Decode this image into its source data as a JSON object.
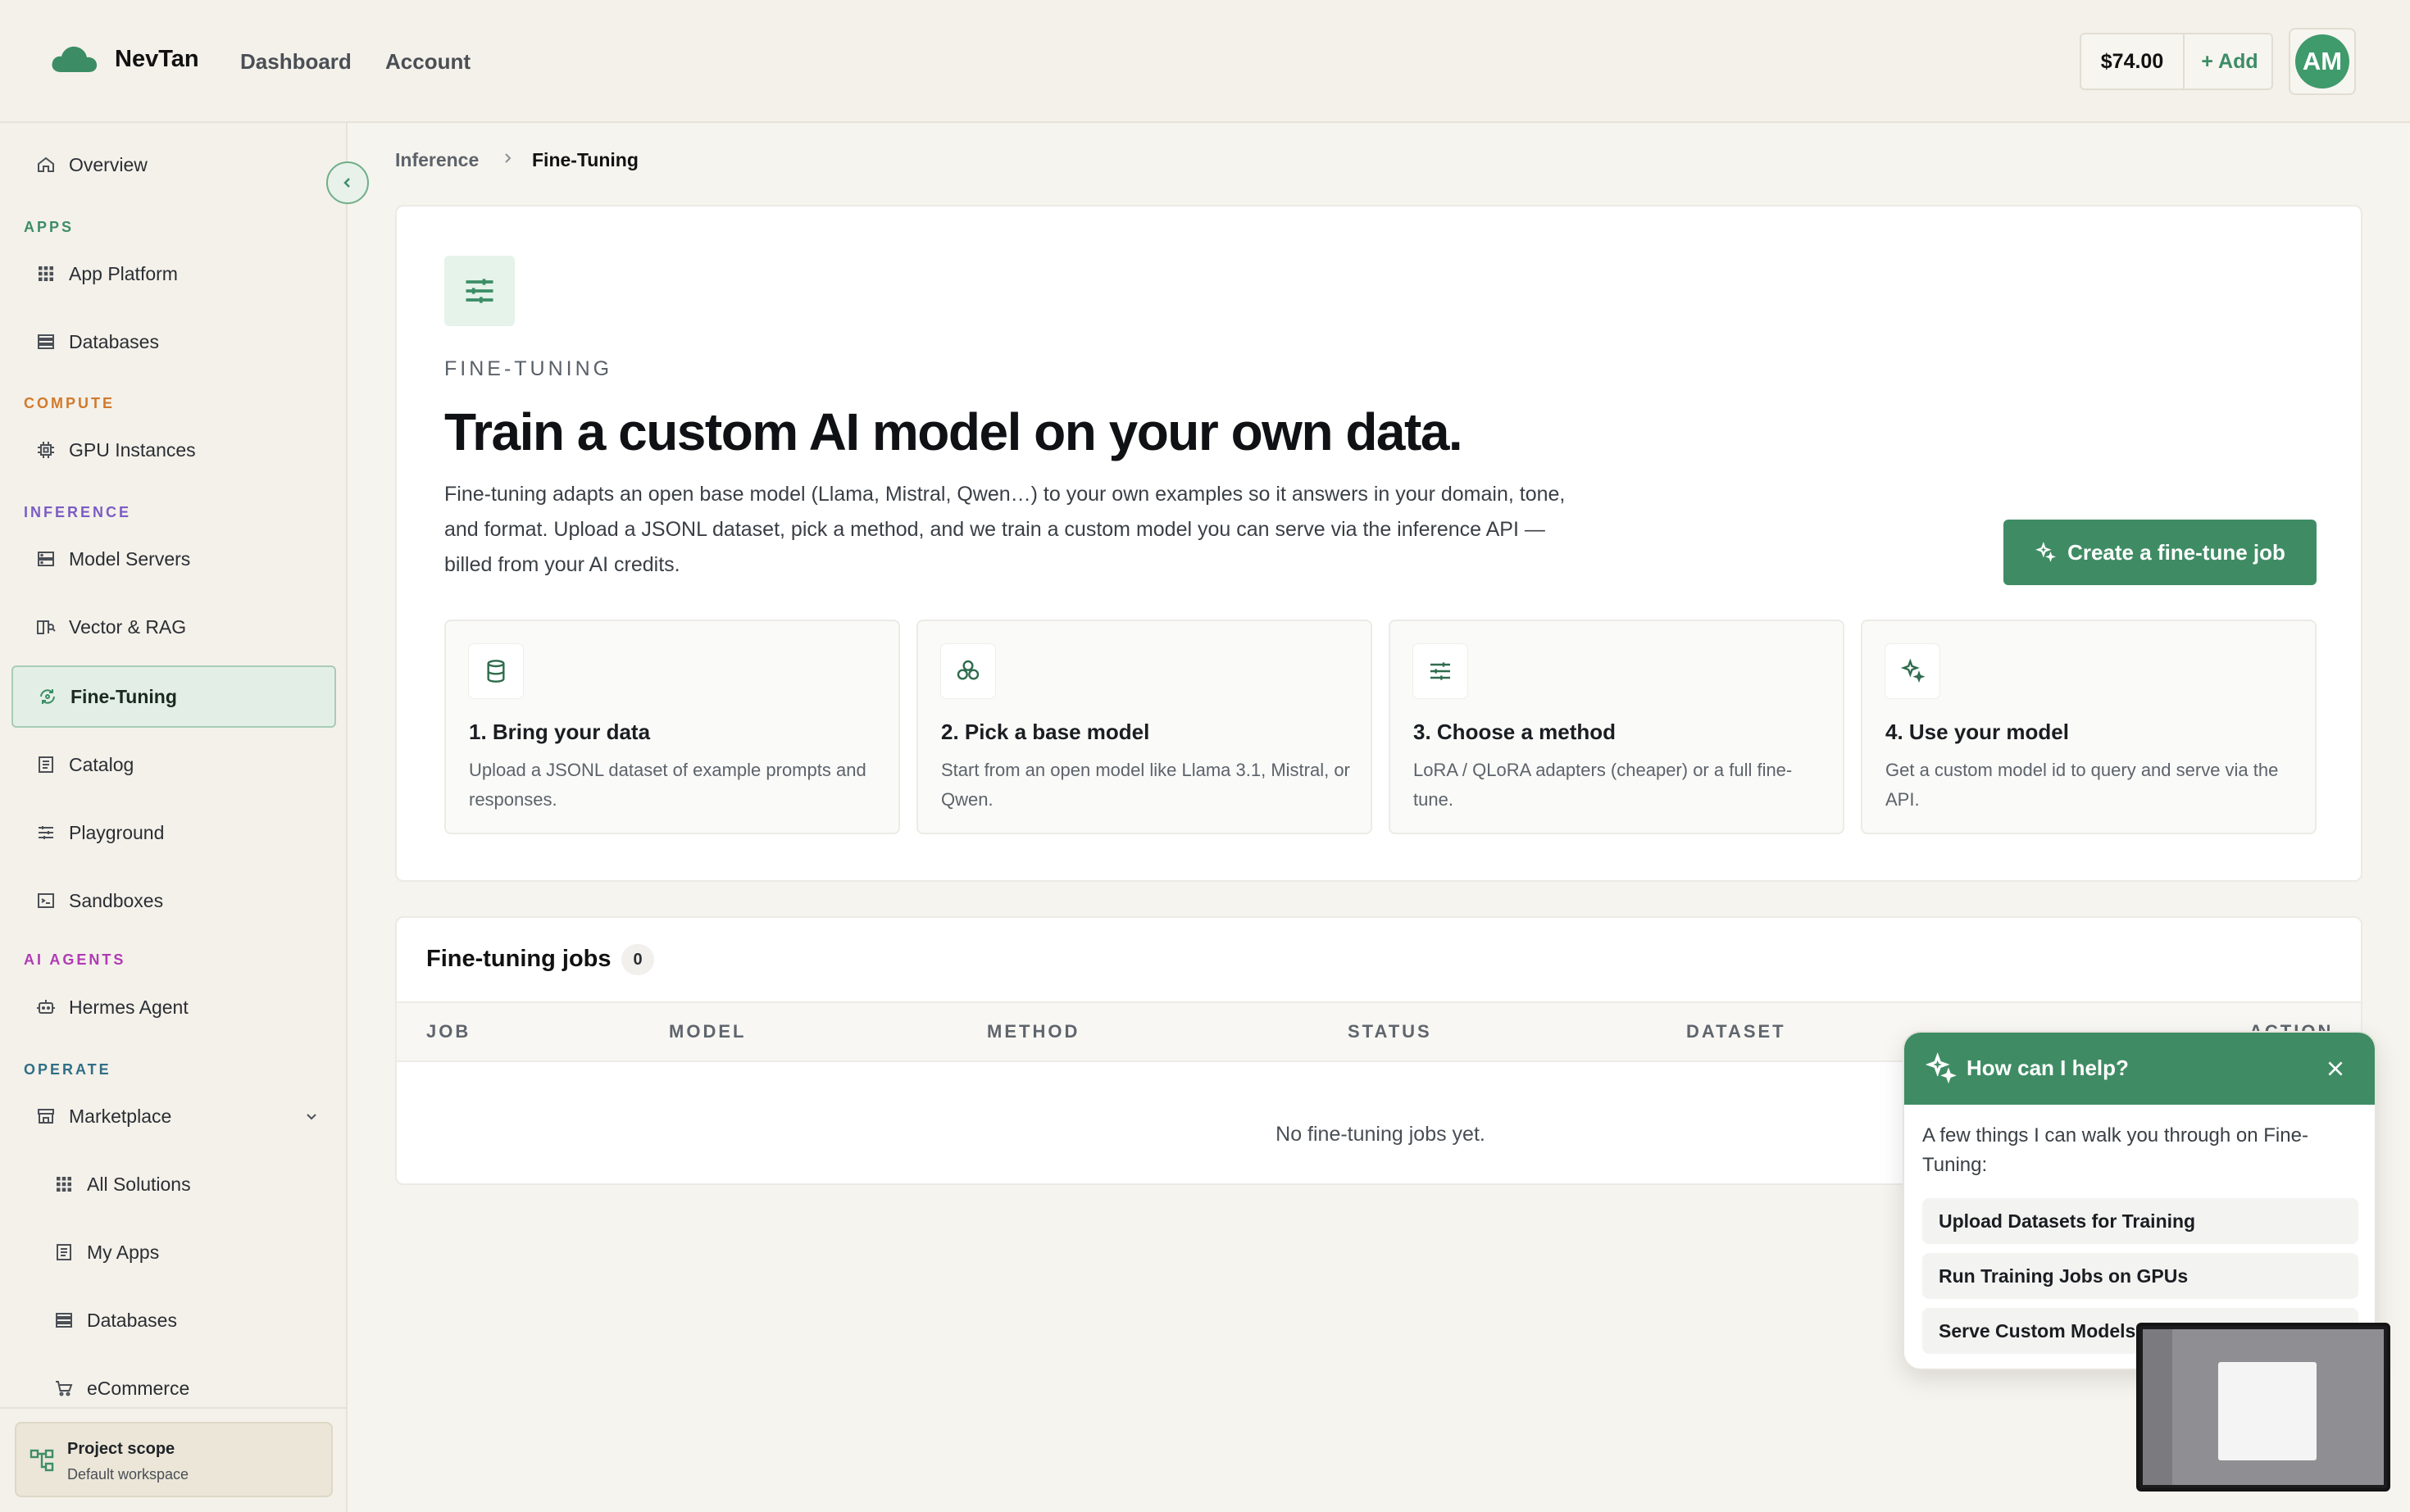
{
  "brand": {
    "name": "NevTan"
  },
  "topnav": {
    "dashboard": "Dashboard",
    "account": "Account"
  },
  "credits": {
    "amount": "$74.00",
    "add_label": "+ Add"
  },
  "user": {
    "initials": "AM"
  },
  "sidebar": {
    "overview": "Overview",
    "sections": {
      "apps": "APPS",
      "compute": "COMPUTE",
      "inference": "INFERENCE",
      "ai_agents": "AI AGENTS",
      "operate": "OPERATE"
    },
    "items": {
      "app_platform": "App Platform",
      "databases": "Databases",
      "gpu_instances": "GPU Instances",
      "model_servers": "Model Servers",
      "vector_rag": "Vector & RAG",
      "fine_tuning": "Fine-Tuning",
      "catalog": "Catalog",
      "playground": "Playground",
      "sandboxes": "Sandboxes",
      "hermes_agent": "Hermes Agent",
      "marketplace": "Marketplace",
      "all_solutions": "All Solutions",
      "my_apps": "My Apps",
      "databases_sub": "Databases",
      "ecommerce": "eCommerce"
    },
    "scope": {
      "title": "Project scope",
      "subtitle": "Default workspace"
    },
    "colors": {
      "apps": "#3c8d66",
      "compute": "#d27a2c",
      "inference": "#7b5cc4",
      "ai_agents": "#b03ab5",
      "operate": "#2f6f86"
    }
  },
  "breadcrumb": {
    "parent": "Inference",
    "current": "Fine-Tuning"
  },
  "hero": {
    "eyebrow": "FINE-TUNING",
    "title": "Train a custom AI model on your own data.",
    "description": "Fine-tuning adapts an open base model (Llama, Mistral, Qwen…) to your own examples so it answers in your domain, tone, and format. Upload a JSONL dataset, pick a method, and we train a custom model you can serve via the inference API — billed from your AI credits.",
    "cta": "Create a fine-tune job"
  },
  "steps": [
    {
      "title": "1. Bring your data",
      "desc": "Upload a JSONL dataset of example prompts and responses.",
      "icon": "database-icon"
    },
    {
      "title": "2. Pick a base model",
      "desc": "Start from an open model like Llama 3.1, Mistral, or Qwen.",
      "icon": "molecule-icon"
    },
    {
      "title": "3. Choose a method",
      "desc": "LoRA / QLoRA adapters (cheaper) or a full fine-tune.",
      "icon": "sliders-icon"
    },
    {
      "title": "4. Use your model",
      "desc": "Get a custom model id to query and serve via the API.",
      "icon": "sparkles-icon"
    }
  ],
  "jobs": {
    "title": "Fine-tuning jobs",
    "count": "0",
    "columns": {
      "job": "JOB",
      "model": "MODEL",
      "method": "METHOD",
      "status": "STATUS",
      "dataset": "DATASET",
      "action": "ACTION"
    },
    "empty": "No fine-tuning jobs yet."
  },
  "assistant": {
    "title": "How can I help?",
    "intro": "A few things I can walk you through on Fine-Tuning:",
    "options": [
      "Upload Datasets for Training",
      "Run Training Jobs on GPUs",
      "Serve Custom Models"
    ]
  },
  "theme": {
    "accent": "#3f8c64"
  }
}
